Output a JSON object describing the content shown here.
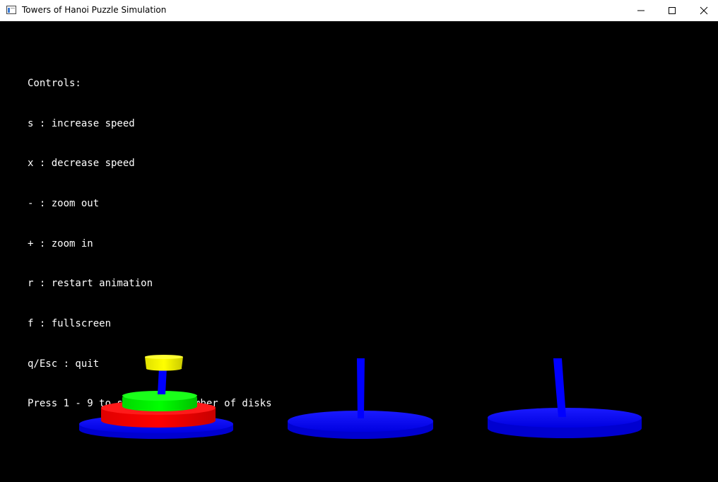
{
  "window": {
    "title": "Towers of Hanoi Puzzle Simulation",
    "icons": [
      "app-icon",
      "minimize-icon",
      "maximize-icon",
      "close-icon"
    ]
  },
  "controls": {
    "heading": "Controls:",
    "lines": [
      "s : increase speed",
      "x : decrease speed",
      "- : zoom out",
      "+ : zoom in",
      "r : restart animation",
      "f : fullscreen",
      "q/Esc : quit",
      "Press 1 - 9 to select the number of disks"
    ]
  },
  "scene": {
    "colors": {
      "background": "#000000",
      "peg": "#0000ff",
      "base": "#0000ff",
      "disk_large": "#ff0000",
      "disk_medium": "#00ff00",
      "disk_small": "#ffff00"
    },
    "disk_count": 3,
    "pegs": [
      {
        "name": "left",
        "disks": [
          "disk_large",
          "disk_medium"
        ]
      },
      {
        "name": "middle",
        "disks": []
      },
      {
        "name": "right",
        "disks": []
      }
    ],
    "moving_disk": "disk_small"
  }
}
